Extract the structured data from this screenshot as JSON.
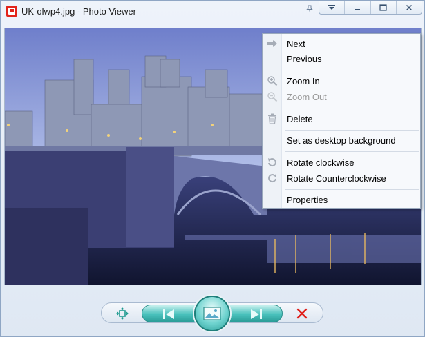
{
  "window": {
    "title": "UK-olwp4.jpg - Photo Viewer",
    "controls": {
      "menu_icon": "dropdown-icon",
      "minimize_icon": "minimize-icon",
      "maximize_icon": "maximize-icon",
      "close_icon": "close-icon"
    }
  },
  "photo": {
    "description_icon": "castle-photo"
  },
  "context_menu": {
    "items": [
      {
        "label": "Next",
        "icon": "arrow-right-icon",
        "enabled": true
      },
      {
        "label": "Previous",
        "icon": "",
        "enabled": true
      },
      {
        "label": "Zoom In",
        "icon": "zoom-in-icon",
        "enabled": true
      },
      {
        "label": "Zoom Out",
        "icon": "zoom-out-icon",
        "enabled": false
      },
      {
        "label": "Delete",
        "icon": "trash-icon",
        "enabled": true
      },
      {
        "label": "Set as desktop background",
        "icon": "",
        "enabled": true
      },
      {
        "label": "Rotate clockwise",
        "icon": "rotate-cw-icon",
        "enabled": true
      },
      {
        "label": "Rotate Counterclockwise",
        "icon": "rotate-ccw-icon",
        "enabled": true
      },
      {
        "label": "Properties",
        "icon": "",
        "enabled": true
      }
    ]
  },
  "toolbar": {
    "fit_icon": "fit-to-window-icon",
    "prev_icon": "previous-icon",
    "slideshow_icon": "slideshow-icon",
    "next_icon": "next-icon",
    "delete_icon": "delete-x-icon"
  },
  "colors": {
    "accent": "#49c1bc",
    "delete": "#e0201b",
    "app_icon": "#e2231a"
  }
}
